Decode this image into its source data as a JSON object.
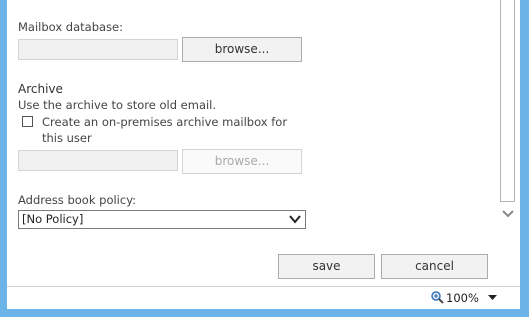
{
  "mailbox_database": {
    "label": "Mailbox database:",
    "browse_label": "browse..."
  },
  "archive": {
    "heading": "Archive",
    "description": "Use the archive to store old email.",
    "checkbox_line1": "Create an on-premises archive mailbox for",
    "checkbox_line2": "this user",
    "checked": false,
    "browse_label": "browse..."
  },
  "address_book_policy": {
    "label": "Address book policy:",
    "selected": "[No Policy]"
  },
  "actions": {
    "save_label": "save",
    "cancel_label": "cancel"
  },
  "statusbar": {
    "zoom": "100%"
  },
  "icons": {
    "zoom": "magnifier-icon",
    "dropdown": "chevron-down-icon"
  }
}
